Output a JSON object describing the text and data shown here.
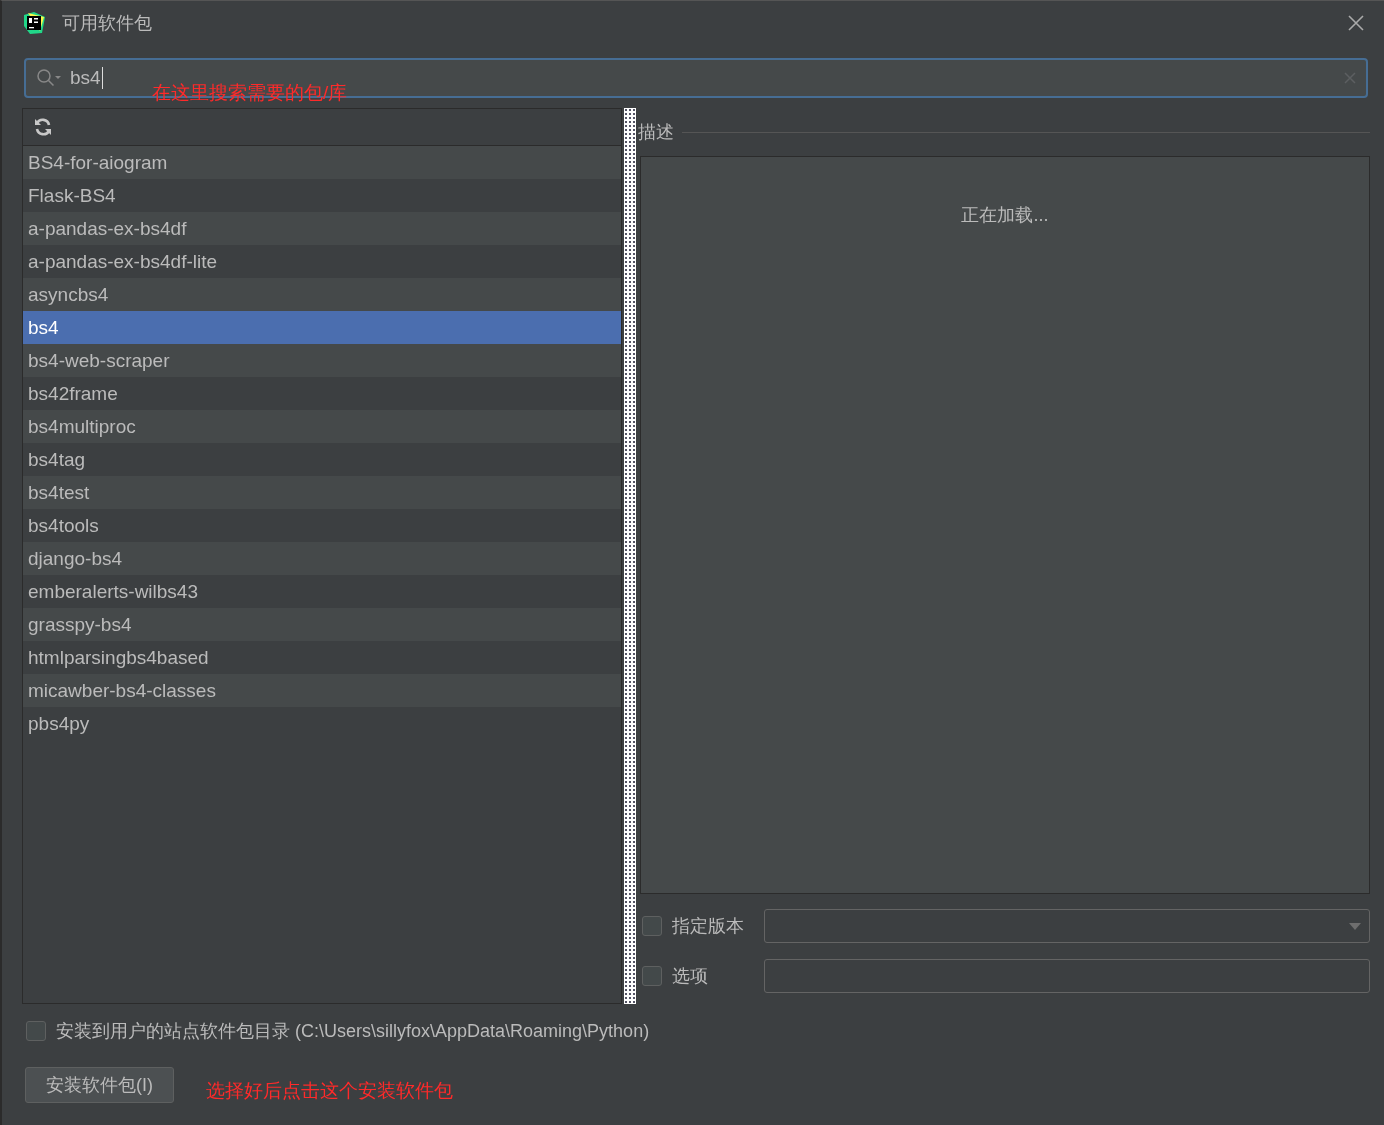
{
  "window": {
    "title": "可用软件包"
  },
  "search": {
    "value": "bs4",
    "annotation": "在这里搜索需要的包/库"
  },
  "packages": [
    {
      "name": "BS4-for-aiogram",
      "selected": false
    },
    {
      "name": "Flask-BS4",
      "selected": false
    },
    {
      "name": "a-pandas-ex-bs4df",
      "selected": false
    },
    {
      "name": "a-pandas-ex-bs4df-lite",
      "selected": false
    },
    {
      "name": "asyncbs4",
      "selected": false
    },
    {
      "name": "bs4",
      "selected": true
    },
    {
      "name": "bs4-web-scraper",
      "selected": false
    },
    {
      "name": "bs42frame",
      "selected": false
    },
    {
      "name": "bs4multiproc",
      "selected": false
    },
    {
      "name": "bs4tag",
      "selected": false
    },
    {
      "name": "bs4test",
      "selected": false
    },
    {
      "name": "bs4tools",
      "selected": false
    },
    {
      "name": "django-bs4",
      "selected": false
    },
    {
      "name": "emberalerts-wilbs43",
      "selected": false
    },
    {
      "name": "grasspy-bs4",
      "selected": false
    },
    {
      "name": "htmlparsingbs4based",
      "selected": false
    },
    {
      "name": "micawber-bs4-classes",
      "selected": false
    },
    {
      "name": "pbs4py",
      "selected": false
    }
  ],
  "description": {
    "title": "描述",
    "status": "正在加载..."
  },
  "options": [
    {
      "kind": "dropdown",
      "label": "指定版本",
      "checked": false
    },
    {
      "kind": "text",
      "label": "选项",
      "checked": false
    }
  ],
  "user_site": {
    "label": "安装到用户的站点软件包目录 (C:\\Users\\sillyfox\\AppData\\Roaming\\Python)",
    "checked": false
  },
  "install_button": {
    "label": "安装软件包(I)",
    "annotation": "选择好后点击这个安装软件包"
  }
}
